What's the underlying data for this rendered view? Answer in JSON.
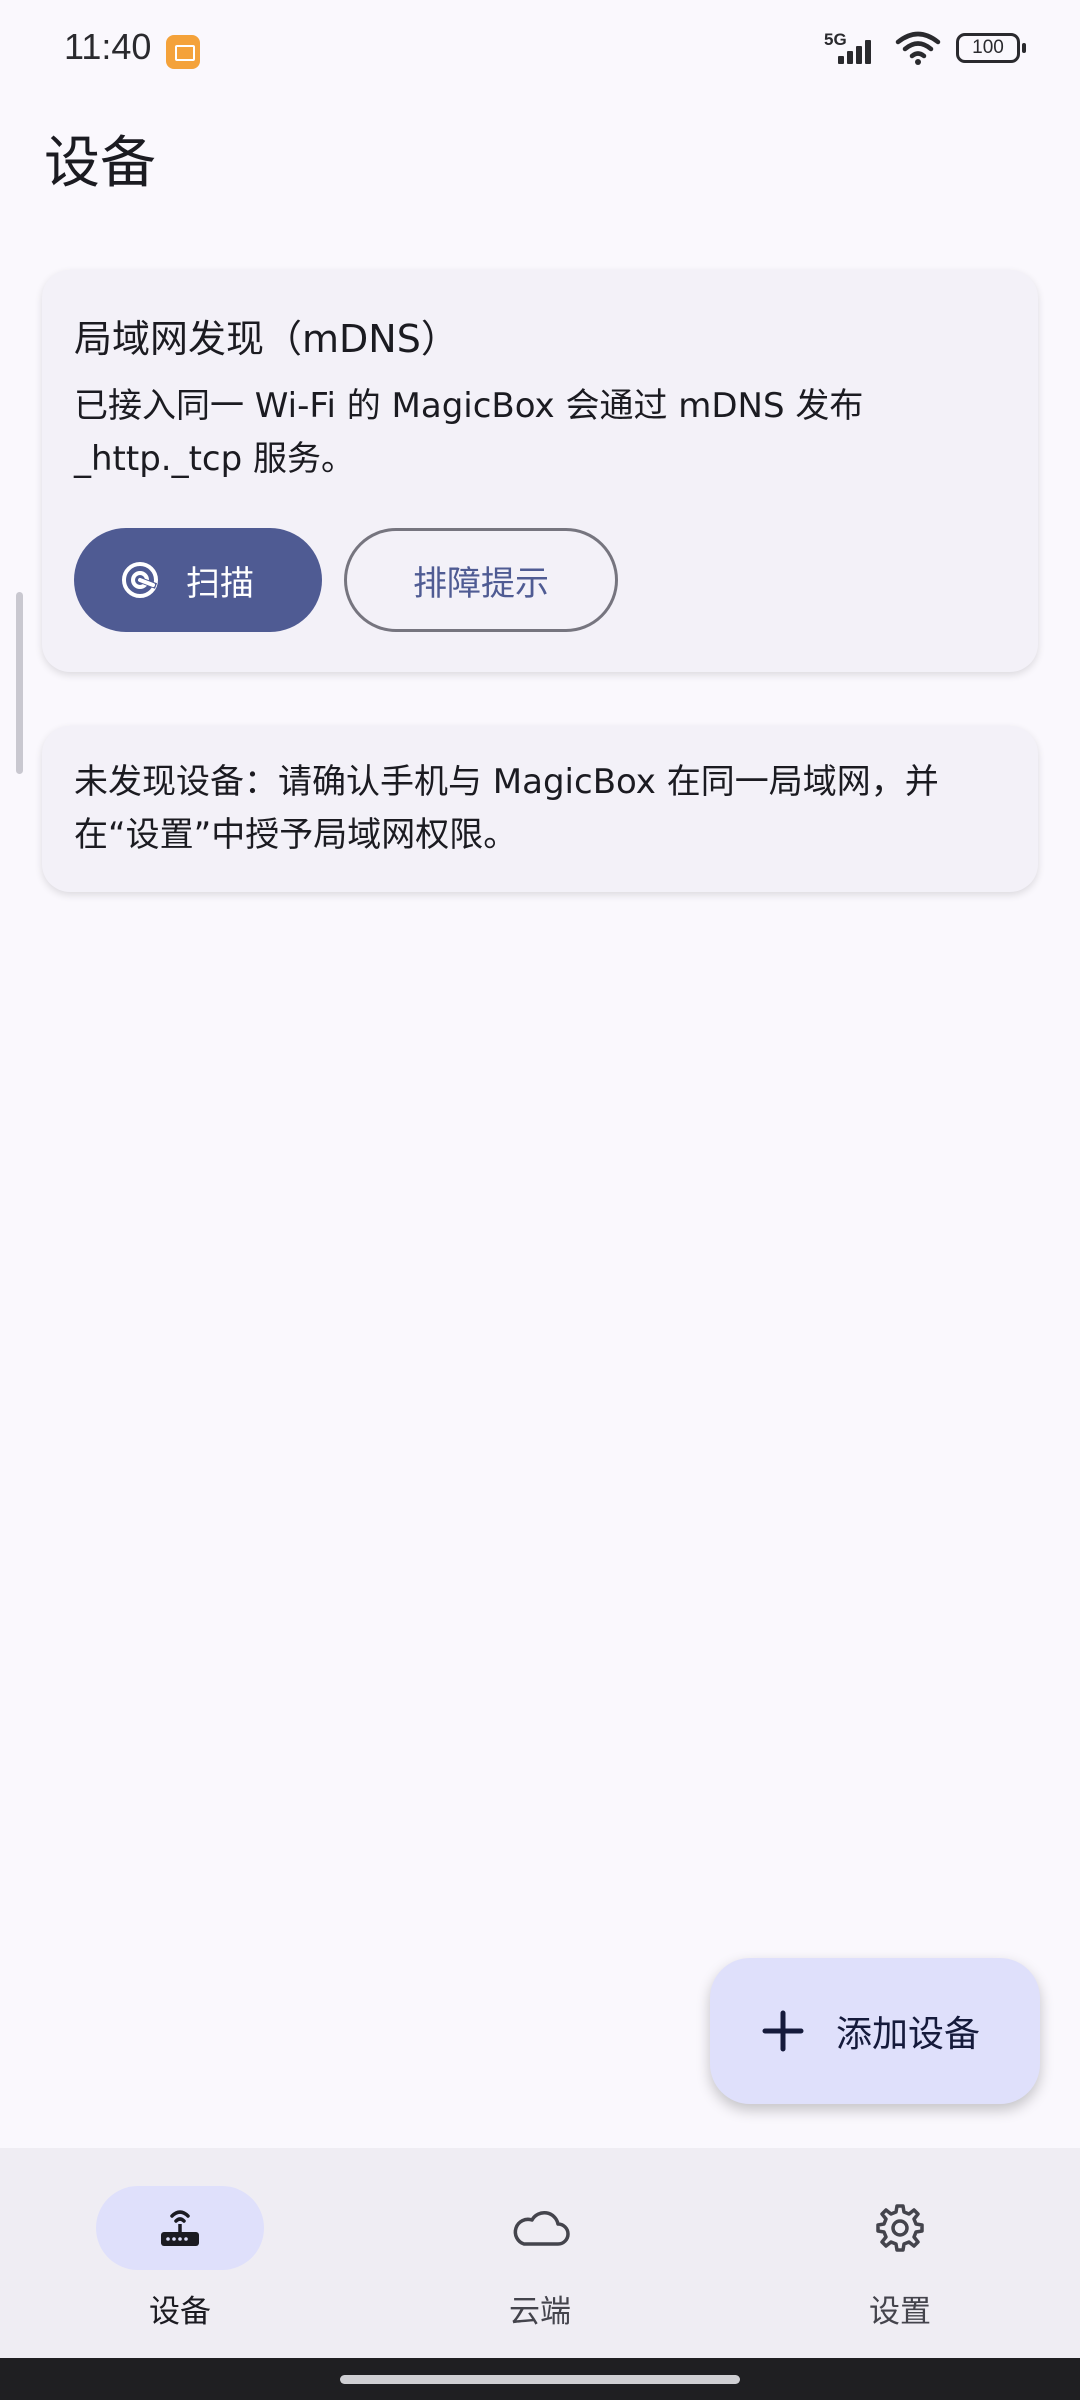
{
  "status_bar": {
    "time": "11:40",
    "network": "5G",
    "battery": "100",
    "icons": [
      "app-notification-icon",
      "signal-icon",
      "wifi-icon",
      "battery-icon"
    ]
  },
  "page": {
    "title": "设备"
  },
  "discovery_card": {
    "title": "局域网发现（mDNS）",
    "description": "已接入同一 Wi-Fi 的 MagicBox 会通过 mDNS 发布 _http._tcp 服务。",
    "scan_label": "扫描",
    "scan_icon": "radar-scan-icon",
    "troubleshoot_label": "排障提示"
  },
  "empty_state": {
    "text": "未发现设备：请确认手机与 MagicBox 在同一局域网，并在“设置”中授予局域网权限。"
  },
  "fab": {
    "label": "添加设备",
    "icon": "plus-icon"
  },
  "bottom_nav": {
    "items": [
      {
        "label": "设备",
        "icon": "router-icon",
        "active": true
      },
      {
        "label": "云端",
        "icon": "cloud-icon",
        "active": false
      },
      {
        "label": "设置",
        "icon": "gear-icon",
        "active": false
      }
    ]
  },
  "colors": {
    "background": "#faf8fd",
    "card": "#f3f1f8",
    "primary": "#4f5b93",
    "primary_container": "#dfe0fb",
    "nav_background": "#efedf3"
  }
}
